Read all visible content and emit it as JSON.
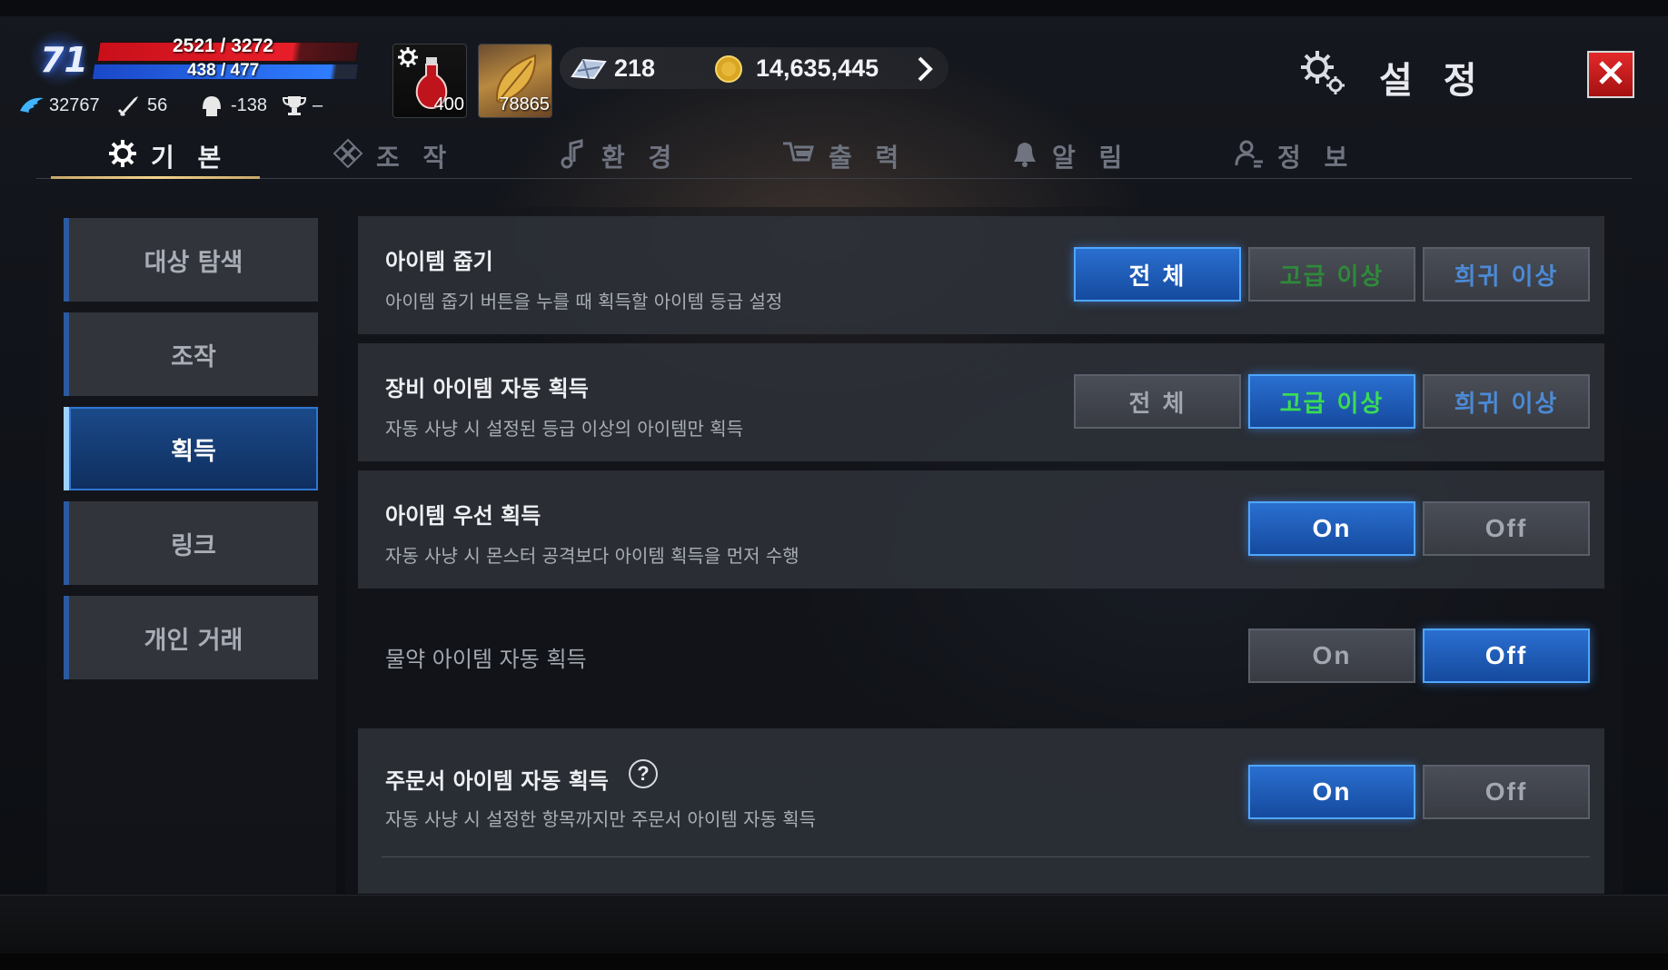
{
  "hud": {
    "level": "71",
    "hp": "2521 / 3272",
    "mp": "438 / 477",
    "stats": [
      {
        "icon": "wing-icon",
        "value": "32767"
      },
      {
        "icon": "sword-icon",
        "value": "56"
      },
      {
        "icon": "helmet-icon",
        "value": "-138"
      },
      {
        "icon": "trophy-icon",
        "value": "–"
      }
    ],
    "items": [
      {
        "icon": "potion-icon",
        "count": "400"
      },
      {
        "icon": "leaf-icon",
        "count": "78865"
      }
    ],
    "diamond": "218",
    "gold": "14,635,445"
  },
  "header": {
    "title": "설 정"
  },
  "tabs": [
    {
      "label": "기 본",
      "icon": "gear-icon",
      "active": true
    },
    {
      "label": "조 작",
      "icon": "dpad-icon",
      "active": false
    },
    {
      "label": "환 경",
      "icon": "music-note-icon",
      "active": false
    },
    {
      "label": "출 력",
      "icon": "monitor-icon",
      "active": false
    },
    {
      "label": "알 림",
      "icon": "bell-icon",
      "active": false
    },
    {
      "label": "정 보",
      "icon": "person-icon",
      "active": false
    }
  ],
  "sidebar": {
    "items": [
      {
        "label": "대상 탐색",
        "active": false
      },
      {
        "label": "조작",
        "active": false
      },
      {
        "label": "획득",
        "active": true
      },
      {
        "label": "링크",
        "active": false
      },
      {
        "label": "개인 거래",
        "active": false
      }
    ]
  },
  "settings": {
    "pickup": {
      "title": "아이템 줍기",
      "desc": "아이템 줍기 버튼을 누를 때 획득할 아이템 등급 설정",
      "opt_all": "전 체",
      "opt_advanced": "고급 이상",
      "opt_rare": "희귀 이상"
    },
    "equip": {
      "title": "장비 아이템 자동 획득",
      "desc": "자동 사냥 시 설정된 등급 이상의 아이템만 획득",
      "opt_all": "전 체",
      "opt_advanced": "고급 이상",
      "opt_rare": "희귀 이상"
    },
    "priority": {
      "title": "아이템 우선 획득",
      "desc": "자동 사냥 시 몬스터 공격보다 아이템 획득을 먼저 수행",
      "on": "On",
      "off": "Off"
    },
    "potion": {
      "title": "물약 아이템 자동 획득",
      "on": "On",
      "off": "Off"
    },
    "scroll": {
      "title": "주문서 아이템 자동 획득",
      "desc": "자동 사냥 시 설정한 항목까지만 주문서 아이템 자동 획득",
      "help": "?",
      "on": "On",
      "off": "Off"
    }
  }
}
